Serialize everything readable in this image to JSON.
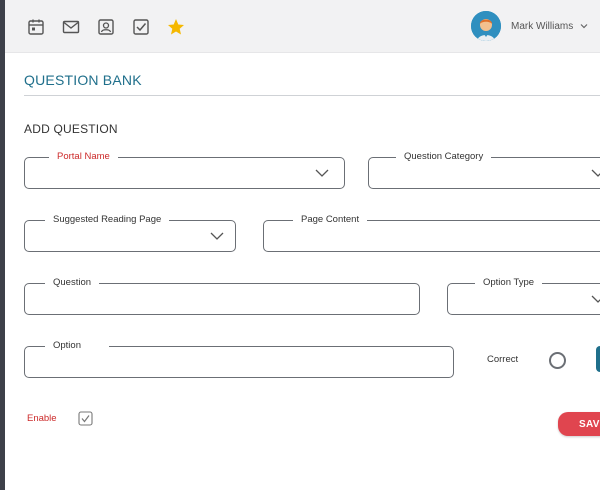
{
  "topbar": {
    "icons": [
      "calendar-icon",
      "mail-icon",
      "contact-icon",
      "checklist-icon",
      "star-icon"
    ],
    "star_color": "#f5b800",
    "user": {
      "name": "Mark Williams",
      "avatar": "avatar-icon"
    }
  },
  "page": {
    "title": "QUESTION BANK",
    "subtitle": "ADD QUESTION"
  },
  "form": {
    "portal_name": {
      "label": "Portal Name",
      "value": ""
    },
    "question_category": {
      "label": "Question Category",
      "value": ""
    },
    "suggested_reading_page": {
      "label": "Suggested Reading Page",
      "value": ""
    },
    "page_content": {
      "label": "Page Content",
      "value": ""
    },
    "question": {
      "label": "Question",
      "value": ""
    },
    "option_type": {
      "label": "Option Type",
      "value": ""
    },
    "option": {
      "label": "Option",
      "value": ""
    },
    "correct_label": "Correct",
    "enable_label": "Enable",
    "enable_checked": true,
    "save_label": "SAVE"
  },
  "colors": {
    "accent": "#1f6f8b",
    "required": "#cc2a2a",
    "save": "#e0454f"
  }
}
